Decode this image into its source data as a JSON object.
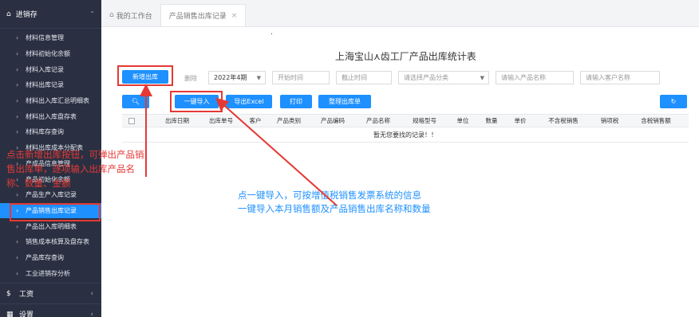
{
  "sidebar": {
    "header": "进销存",
    "items": [
      {
        "label": "材料信息管理"
      },
      {
        "label": "材料初始化余额"
      },
      {
        "label": "材料入库记录"
      },
      {
        "label": "材料出库记录"
      },
      {
        "label": "材料出入库汇总明细表"
      },
      {
        "label": "材料出入库盘存表"
      },
      {
        "label": "材料库存查询"
      },
      {
        "label": "材料出库成本分配表"
      },
      {
        "label": "产成品信息管理"
      },
      {
        "label": "产品初始化余额"
      },
      {
        "label": "产品生产入库记录"
      },
      {
        "label": "产品销售出库记录"
      },
      {
        "label": "产品出入库明细表"
      },
      {
        "label": "销售成本核算及盘存表"
      },
      {
        "label": "产品库存查询"
      },
      {
        "label": "工业进销存分析"
      }
    ],
    "groups": [
      {
        "label": "工资",
        "icon": "dollar-icon"
      },
      {
        "label": "设置",
        "icon": "grid-icon"
      }
    ]
  },
  "tabs": [
    {
      "label": "我的工作台"
    },
    {
      "label": "产品销售出库记录"
    }
  ],
  "main": {
    "dot": ".",
    "title": "上海宝山⋏齿工厂产品出库统计表",
    "toolbar": {
      "new_label": "新增出库",
      "delete_label": "删除",
      "period_value": "2022年4期",
      "start_placeholder": "开始时间",
      "end_placeholder": "截止时间",
      "category_placeholder": "请选择产品分类",
      "product_placeholder": "请输入产品名称",
      "customer_placeholder": "请输入客户名称",
      "import_label": "一键导入",
      "export_label": "导出Excel",
      "print_label": "打印",
      "organize_label": "整理出库单"
    },
    "table": {
      "headers": [
        "出库日期",
        "出库单号",
        "客户",
        "产品类别",
        "产品编码",
        "产品名称",
        "规格型号",
        "单位",
        "数量",
        "单价",
        "不含税销售",
        "销项税",
        "含税销售额"
      ],
      "empty_text": "暂无您要找的记录！！"
    }
  },
  "annotations": {
    "note1": "点击新增出库按钮，可弹出产品销售出库单，逐项输入出库产品名称、数量、金额",
    "note2_line1": "点一键导入，可按增值税销售发票系统的信息",
    "note2_line2": "一键导入本月销售额及产品销售出库名称和数量"
  },
  "colors": {
    "accent": "#1e90ff",
    "sidebar_bg": "#2a3042",
    "annotation_red": "#e53935",
    "annotation_blue": "#1e90ff"
  }
}
